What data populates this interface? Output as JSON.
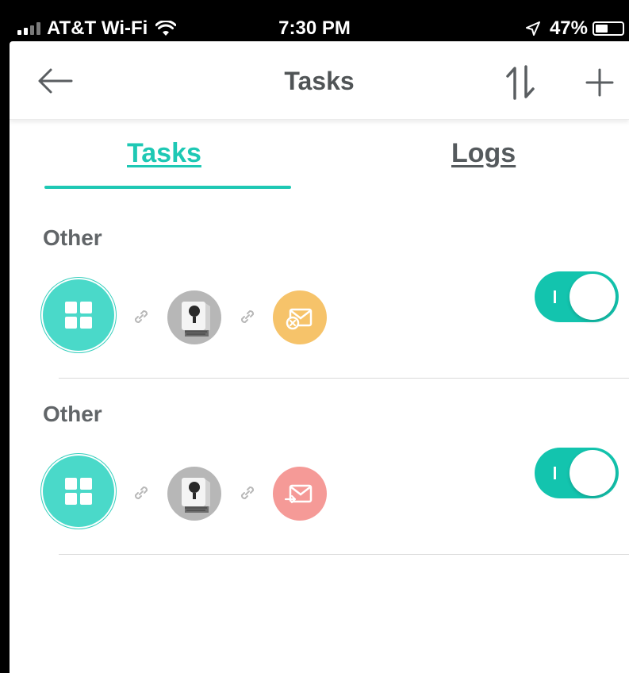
{
  "status_bar": {
    "carrier": "AT&T Wi-Fi",
    "time": "7:30 PM",
    "battery": "47%",
    "battery_level": 0.47,
    "signal_bars": 4,
    "signal_strength": 2
  },
  "nav": {
    "title": "Tasks",
    "back_icon": "arrow-left-icon",
    "sort_icon": "sort-arrows-icon",
    "add_icon": "plus-icon"
  },
  "tabs": [
    {
      "label": "Tasks",
      "active": true
    },
    {
      "label": "Logs",
      "active": false
    }
  ],
  "colors": {
    "accent": "#1ec8b4",
    "hub": "#4ad9c9",
    "email_blocked": "#f6c36a",
    "email_send": "#f59a97",
    "title_text": "#505456"
  },
  "tasks": [
    {
      "label": "Other",
      "enabled": true,
      "trigger_icon": "hub-grid-icon",
      "device_icon": "camera-icon",
      "action_icon": "email-blocked-icon"
    },
    {
      "label": "Other",
      "enabled": true,
      "trigger_icon": "hub-grid-icon",
      "device_icon": "camera-icon",
      "action_icon": "email-send-icon"
    }
  ]
}
